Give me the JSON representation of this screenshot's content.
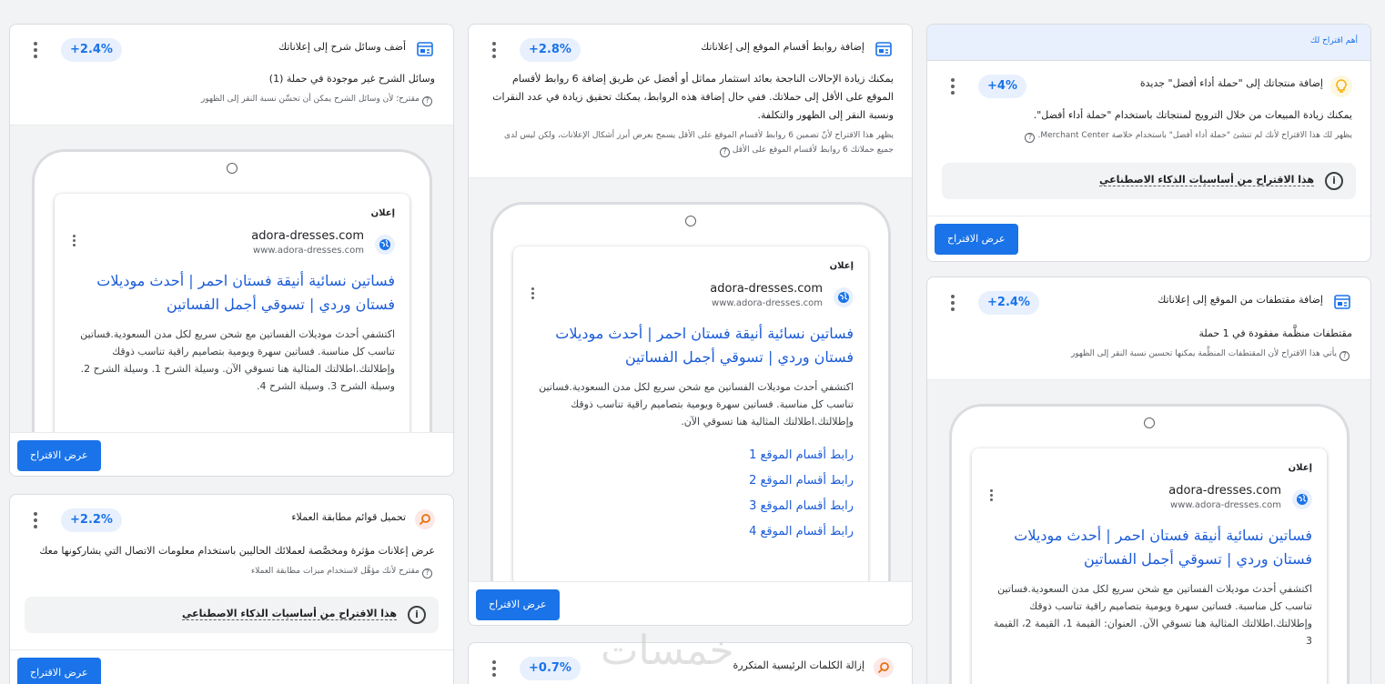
{
  "ad_preview": {
    "ad_label": "إعلان",
    "site_name": "adora-dresses.com",
    "site_url": "www.adora-dresses.com",
    "headline": "فساتين نسائية أنيقة فستان احمر | أحدث موديلات فستان وردي | تسوقي أجمل الفساتين"
  },
  "top_card": {
    "banner": "أهم اقتراح لك",
    "title": "إضافة منتجاتك إلى \"حملة أداء أفضل\" جديدة",
    "badge": "+4%",
    "description": "يمكنك زيادة المبيعات من خلال الترويج لمنتجاتك باستخدام \"حملة أداء أفضل\".",
    "note": "يظهر لك هذا الاقتراح لأنك لم تنشئ \"حملة أداء أفضل\" باستخدام خلاصة Merchant Center.",
    "ai_text": "هذا الاقتراح من أساسيات الذكاء الاصطناعي",
    "button": "عرض الاقتراح"
  },
  "callout_card": {
    "title": "أضف وسائل شرح إلى إعلاناتك",
    "badge": "+2.4%",
    "description": "وسائل الشرح غير موجودة في حملة (1)",
    "note": "مقترح؛ لأن وسائل الشرح يمكن أن تحسِّن نسبة النقر إلى الظهور",
    "ad_body": "اكتشفي أحدث موديلات الفساتين مع شحن سريع لكل مدن السعودية.فساتين تناسب كل مناسبة. فساتين سهرة ويومية بتصاميم راقية تناسب ذوقك وإطلالتك.اطلالتك المثالية هنا تسوقي الآن. وسيلة الشرح 1. وسيلة الشرح 2. وسيلة الشرح 3. وسيلة الشرح 4.",
    "button": "عرض الاقتراح"
  },
  "customer_match_card": {
    "title": "تحميل قوائم مطابقة العملاء",
    "badge": "+2.2%",
    "description": "عرض إعلانات مؤثرة ومخصَّصة لعملائك الحاليين باستخدام معلومات الاتصال التي يشاركونها معك",
    "note": "مقترح لأنك مؤهَّل لاستخدام ميزات مطابقة العملاء",
    "ai_text": "هذا الاقتراح من أساسيات الذكاء الاصطناعي",
    "button": "عرض الاقتراح"
  },
  "sitelinks_card": {
    "title": "إضافة روابط أقسام الموقع إلى إعلاناتك",
    "badge": "+2.8%",
    "description": "يمكنك زيادة الإحالات الناجحة بعائد استثمار مماثل أو أفضل عن طريق إضافة 6 روابط لأقسام الموقع على الأقل إلى حملاتك. ففي حال إضافة هذه الروابط، يمكنك تحقيق زيادة في عدد النقرات ونسبة النقر إلى الظهور والتكلفة.",
    "note": "يظهر هذا الاقتراح لأنّ تضمين 6 روابط لأقسام الموقع على الأقل يسمح بعرض أبرز أشكال الإعلانات، ولكن ليس لدى جميع حملاتك 6 روابط لأقسام الموقع على الأقل",
    "ad_body": "اكتشفي أحدث موديلات الفساتين مع شحن سريع لكل مدن السعودية.فساتين تناسب كل مناسبة. فساتين سهرة ويومية بتصاميم راقية تناسب ذوقك وإطلالتك.اطلالتك المثالية هنا تسوقي الآن.",
    "sitelinks": [
      "رابط أقسام الموقع 1",
      "رابط أقسام الموقع 2",
      "رابط أقسام الموقع 3",
      "رابط أقسام الموقع 4"
    ],
    "button": "عرض الاقتراح"
  },
  "keywords_card": {
    "title": "إزالة الكلمات الرئيسية المتكررة",
    "badge": "+0.7%"
  },
  "snippets_card": {
    "title": "إضافة مقتطفات من الموقع إلى إعلاناتك",
    "badge": "+2.4%",
    "description": "مقتطفات منظَّمة مفقودة في 1 حملة",
    "note": "يأتي هذا الاقتراح لأن المقتطفات المنظَّمة يمكنها تحسين نسبة النقر إلى الظهور",
    "ad_body": "اكتشفي أحدث موديلات الفساتين مع شحن سريع لكل مدن السعودية.فساتين تناسب كل مناسبة. فساتين سهرة ويومية بتصاميم راقية تناسب ذوقك وإطلالتك.اطلالتك المثالية هنا تسوقي الآن. العنوان: القيمة 1، القيمة 2، القيمة 3"
  },
  "watermark": "خمسات",
  "colors": {
    "accent": "#1a73e8",
    "badge_bg": "#e8f0fe",
    "headline": "#1a5bd8"
  }
}
